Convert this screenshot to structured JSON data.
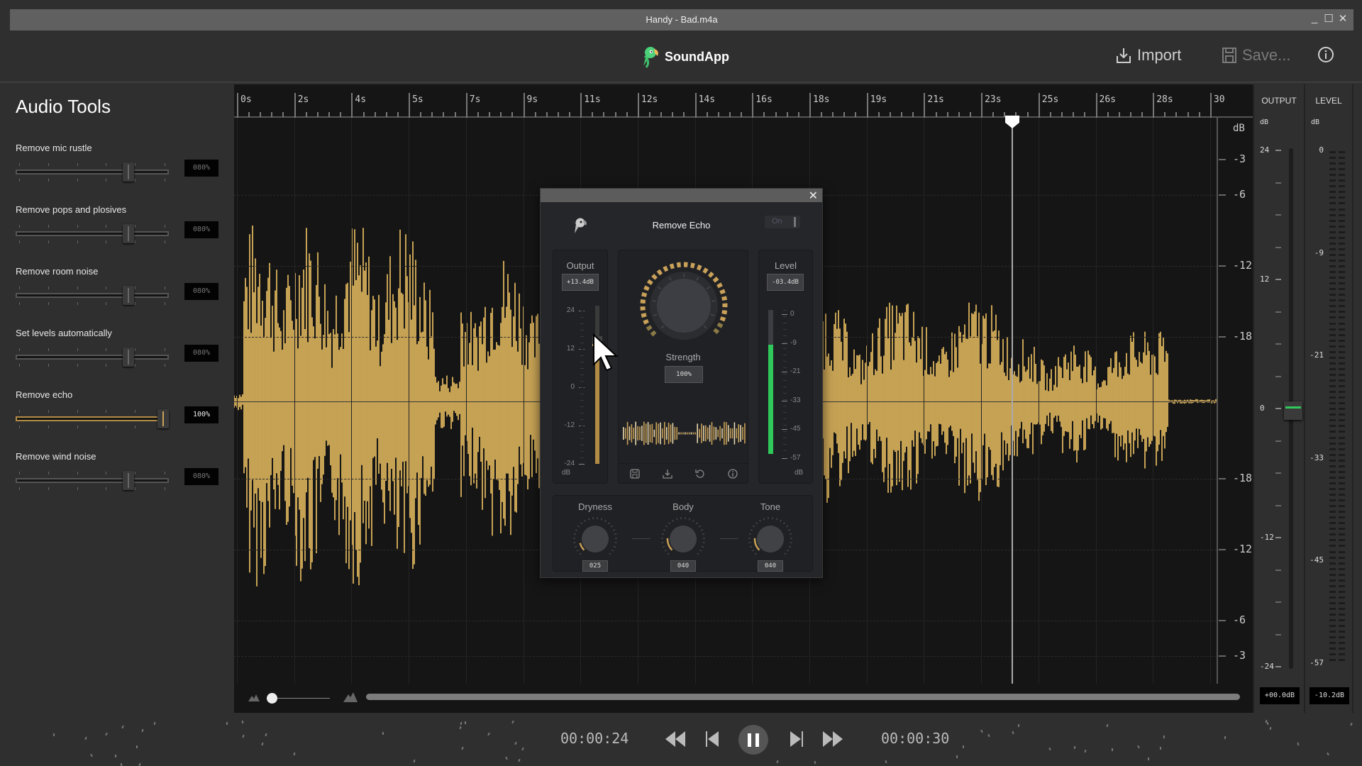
{
  "window": {
    "title": "Handy - Bad.m4a",
    "controls": {
      "minimize": "_",
      "maximize": "☐",
      "close": "✕"
    }
  },
  "header": {
    "app_name": "SoundApp",
    "import_label": "Import",
    "save_label": "Save...",
    "info_icon": "info-icon"
  },
  "sidebar": {
    "title": "Audio Tools",
    "tools": [
      {
        "label": "Remove mic rustle",
        "value": "080%",
        "level": 0.8,
        "active": false
      },
      {
        "label": "Remove pops and plosives",
        "value": "080%",
        "level": 0.8,
        "active": false
      },
      {
        "label": "Remove room noise",
        "value": "080%",
        "level": 0.8,
        "active": false
      },
      {
        "label": "Set levels automatically",
        "value": "080%",
        "level": 0.8,
        "active": false
      },
      {
        "label": "Remove echo",
        "value": "100%",
        "level": 1.0,
        "active": true
      },
      {
        "label": "Remove wind noise",
        "value": "080%",
        "level": 0.8,
        "active": false
      }
    ]
  },
  "timeline": {
    "ruler_labels": [
      "0s",
      "2s",
      "4s",
      "5s",
      "7s",
      "9s",
      "11s",
      "12s",
      "14s",
      "16s",
      "18s",
      "19s",
      "21s",
      "23s",
      "25s",
      "26s",
      "28s",
      "30"
    ],
    "db_unit": "dB",
    "db_labels_top": [
      "-3",
      "-6",
      "-12",
      "-18"
    ],
    "db_labels_bottom": [
      "-18",
      "-12",
      "-6",
      "-3"
    ],
    "playhead_seconds": 24,
    "waveform_color": "#f2c565"
  },
  "output_panel": {
    "title": "OUTPUT",
    "unit": "dB",
    "scale": [
      "24",
      "12",
      "0",
      "-12",
      "-24"
    ],
    "fader_value_db": 0,
    "readout": "+00.0dB"
  },
  "level_panel": {
    "title": "LEVEL",
    "unit": "dB",
    "scale": [
      "0",
      "-9",
      "-21",
      "-33",
      "-45",
      "-57"
    ],
    "readout": "-10.2dB"
  },
  "transport": {
    "current_time": "00:00:24",
    "total_time": "00:00:30",
    "state": "playing"
  },
  "dialog": {
    "title": "Remove Echo",
    "toggle_label": "On",
    "output": {
      "label": "Output",
      "readout": "+13.4dB",
      "scale": [
        "24",
        "12",
        "0",
        "-12",
        "-24"
      ],
      "unit": "dB",
      "fader_value_db": 13.4
    },
    "strength": {
      "label": "Strength",
      "readout": "100%",
      "value": 1.0
    },
    "level": {
      "label": "Level",
      "readout": "-03.4dB",
      "scale": [
        "0",
        "-9",
        "-21",
        "-33",
        "-45",
        "-57"
      ],
      "unit": "dB",
      "fill": 0.76
    },
    "knobs": [
      {
        "label": "Dryness",
        "readout": "025",
        "value": 0.25
      },
      {
        "label": "Body",
        "readout": "040",
        "value": 0.4
      },
      {
        "label": "Tone",
        "readout": "040",
        "value": 0.4
      }
    ],
    "footer_icons": [
      "save-icon",
      "download-icon",
      "undo-icon",
      "info-icon"
    ]
  },
  "colors": {
    "accent": "#c9a158",
    "waveform": "#f2c565",
    "meter_green": "#2fc85a",
    "logo_green": "#4cd07a"
  }
}
